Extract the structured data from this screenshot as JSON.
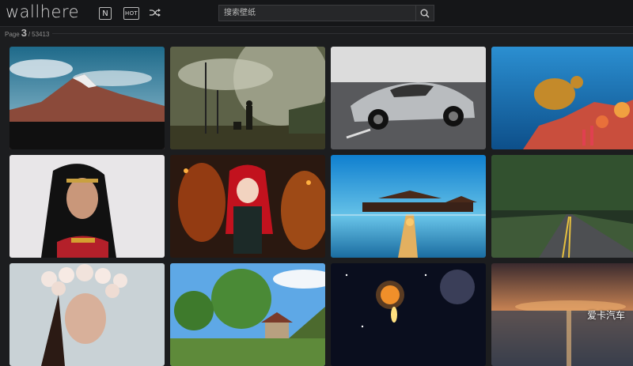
{
  "header": {
    "logo": "wallhere",
    "new_label": "N",
    "hot_label": "HOT",
    "search_placeholder": "搜索壁纸"
  },
  "pagination": {
    "prefix": "Page",
    "current": "3",
    "separator": "/",
    "total": "53413"
  },
  "watermark": "爱卡汽车",
  "wallpapers": [
    {
      "subject": "mountain landscape"
    },
    {
      "subject": "fallout soldier"
    },
    {
      "subject": "silver supercar"
    },
    {
      "subject": "sea turtle reef"
    },
    {
      "subject": "wonder woman portrait"
    },
    {
      "subject": "anime girl fire"
    },
    {
      "subject": "ocean villa pier"
    },
    {
      "subject": "forest road"
    },
    {
      "subject": "flower crown woman"
    },
    {
      "subject": "willow tree house"
    },
    {
      "subject": "space explosion"
    },
    {
      "subject": "sunset sea"
    }
  ]
}
